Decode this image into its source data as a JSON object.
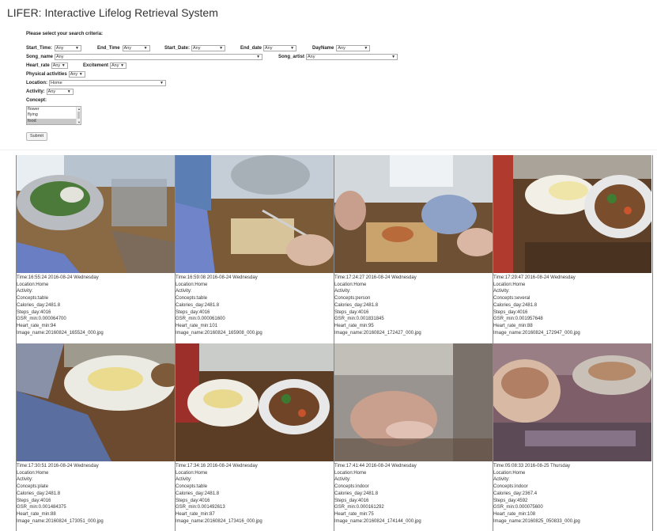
{
  "app": {
    "title": "LIFER: Interactive Lifelog Retrieval System"
  },
  "form": {
    "heading": "Please select your search criteria:",
    "start_time": {
      "label": "Start_Time:",
      "value": "Any"
    },
    "end_time": {
      "label": "End_Time",
      "value": "Any"
    },
    "start_date": {
      "label": "Start_Date:",
      "value": "Any"
    },
    "end_date": {
      "label": "End_date",
      "value": "Any"
    },
    "dayname": {
      "label": "DayName",
      "value": "Any"
    },
    "song_name": {
      "label": "Song_name",
      "value": "Any"
    },
    "song_artist": {
      "label": "Song_artist",
      "value": "Any"
    },
    "heart_rate": {
      "label": "Heart_rate",
      "value": "Any"
    },
    "excitement": {
      "label": "Excitement",
      "value": "Any"
    },
    "physical": {
      "label": "Physical activities",
      "value": "Any"
    },
    "location": {
      "label": "Location:",
      "value": "Home"
    },
    "activity": {
      "label": "Activity:",
      "value": "Any"
    },
    "concept": {
      "label": "Concept:",
      "options": [
        "flower",
        "flying",
        "food"
      ],
      "selected": "food"
    },
    "submit_label": "Submit"
  },
  "results": [
    {
      "time": "Time:16:55:24  2016-08-24  Wednesday",
      "location": "Location:Home",
      "activity": "Activity:",
      "concepts": "Concepts:table",
      "calories": "Calories_day:2481.8",
      "steps": "Steps_day:4016",
      "gsr": "GSR_min:0.000064700",
      "heart": "Heart_rate_min:94",
      "image": "Image_name:20160824_165524_000.jpg"
    },
    {
      "time": "Time:16:59:08  2016-08-24  Wednesday",
      "location": "Location:Home",
      "activity": "Activity:",
      "concepts": "Concepts:table",
      "calories": "Calories_day:2481.8",
      "steps": "Steps_day:4016",
      "gsr": "GSR_min:0.000061600",
      "heart": "Heart_rate_min:101",
      "image": "Image_name:20160824_165908_000.jpg"
    },
    {
      "time": "Time:17:24:27  2016-08-24  Wednesday",
      "location": "Location:Home",
      "activity": "Activity:",
      "concepts": "Concepts:person",
      "calories": "Calories_day:2481.8",
      "steps": "Steps_day:4016",
      "gsr": "GSR_min:0.001831845",
      "heart": "Heart_rate_min:95",
      "image": "Image_name:20160824_172427_000.jpg"
    },
    {
      "time": "Time:17:29:47  2016-08-24  Wednesday",
      "location": "Location:Home",
      "activity": "Activity:",
      "concepts": "Concepts:several",
      "calories": "Calories_day:2481.8",
      "steps": "Steps_day:4016",
      "gsr": "GSR_min:0.001957648",
      "heart": "Heart_rate_min:88",
      "image": "Image_name:20160824_172947_000.jpg"
    },
    {
      "time": "Time:17:30:51  2016-08-24  Wednesday",
      "location": "Location:Home",
      "activity": "Activity:",
      "concepts": "Concepts:plate",
      "calories": "Calories_day:2481.8",
      "steps": "Steps_day:4016",
      "gsr": "GSR_min:0.001484375",
      "heart": "Heart_rate_min:88",
      "image": "Image_name:20160824_173051_000.jpg"
    },
    {
      "time": "Time:17:34:16  2016-08-24  Wednesday",
      "location": "Location:Home",
      "activity": "Activity:",
      "concepts": "Concepts:table",
      "calories": "Calories_day:2481.8",
      "steps": "Steps_day:4016",
      "gsr": "GSR_min:0.001492613",
      "heart": "Heart_rate_min:87",
      "image": "Image_name:20160824_173416_000.jpg"
    },
    {
      "time": "Time:17:41:44  2016-08-24  Wednesday",
      "location": "Location:Home",
      "activity": "Activity:",
      "concepts": "Concepts:indoor",
      "calories": "Calories_day:2481.8",
      "steps": "Steps_day:4016",
      "gsr": "GSR_min:0.000161292",
      "heart": "Heart_rate_min:75",
      "image": "Image_name:20160824_174144_000.jpg"
    },
    {
      "time": "Time:05:08:33  2016-08-25  Thursday",
      "location": "Location:Home",
      "activity": "Activity:",
      "concepts": "Concepts:indoor",
      "calories": "Calories_day:2367.4",
      "steps": "Steps_day:4592",
      "gsr": "GSR_min:0.000075600",
      "heart": "Heart_rate_min:108",
      "image": "Image_name:20160825_050833_000.jpg"
    }
  ]
}
